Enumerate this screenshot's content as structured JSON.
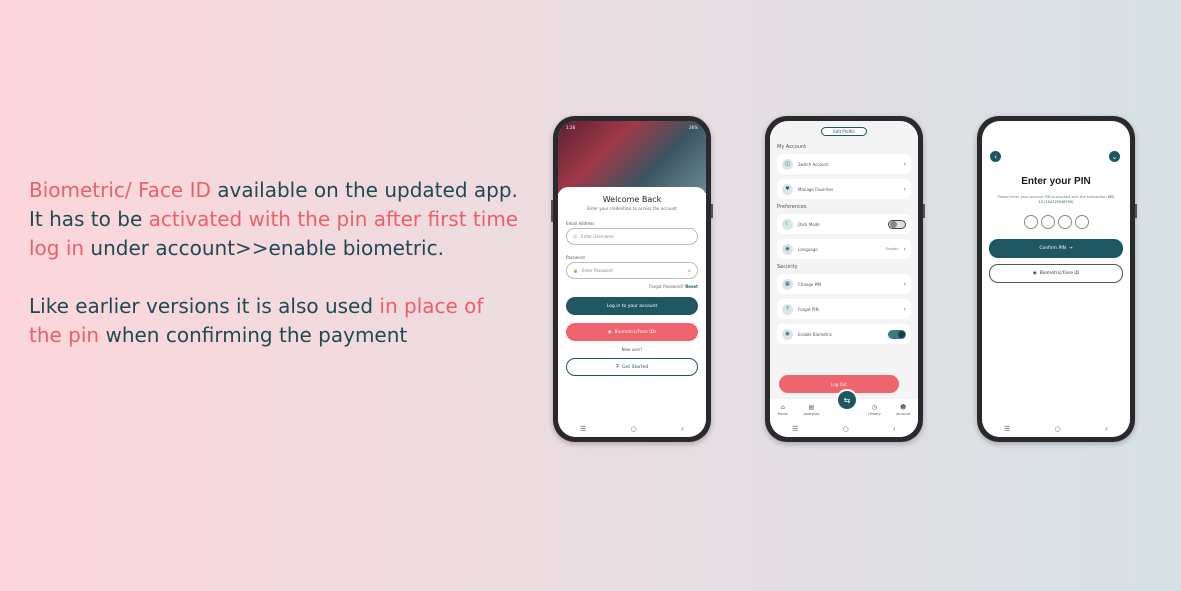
{
  "description": {
    "para1": [
      {
        "text": "Biometric/ Face ID",
        "highlight": true
      },
      {
        "text": " available on the updated app. It has to be ",
        "highlight": false
      },
      {
        "text": "activated with the pin after first time log in",
        "highlight": true
      },
      {
        "text": " under account>>enable biometric.",
        "highlight": false
      }
    ],
    "para2": [
      {
        "text": "Like earlier versions it is also used ",
        "highlight": false
      },
      {
        "text": "in place of the pin",
        "highlight": true
      },
      {
        "text": " when confirming the payment",
        "highlight": false
      }
    ]
  },
  "colors": {
    "highlight": "#ea5f6a",
    "text": "#1f4a55",
    "teal": "#1e5762",
    "coral": "#f06470"
  },
  "phone1": {
    "status_time": "1:28",
    "status_battery": "26%",
    "title": "Welcome Back",
    "subtitle": "Enter your credentials to access the account",
    "email_label": "Email Address",
    "email_placeholder": "Enter Username",
    "password_label": "Password",
    "password_placeholder": "Enter Password",
    "forgot_text": "Forgot Password?",
    "reset_text": "Reset",
    "login_button": "Log in to your account",
    "biometric_button": "Biometric/Face IDs",
    "new_user": "New user?",
    "get_started": "Get Started",
    "icons": {
      "user": "user-icon",
      "lock": "lock-icon",
      "eye": "eye-off-icon",
      "fingerprint": "fingerprint-icon",
      "shield": "shield-check-icon"
    }
  },
  "phone2": {
    "edit_profile": "Edit Profile",
    "section_account": "My Account",
    "switch_account": "Switch Account",
    "manage_favorites": "Manage Favorites",
    "section_preferences": "Preferences",
    "dark_mode": "Dark Mode",
    "language": "Language",
    "language_value": "English",
    "section_security": "Security",
    "change_pin": "Change PIN",
    "forgot_pin": "Forgot PIN",
    "enable_biometric": "Enable Biometric",
    "dark_mode_on": false,
    "biometric_on": true,
    "logout": "Log Out",
    "tabs": [
      "Home",
      "Analytics",
      "History",
      "Account"
    ]
  },
  "phone3": {
    "title": "Enter your PIN",
    "subtitle": "Please enter your account PIN to proceed with the transaction",
    "txn_id": "KES 10 (254725538790)",
    "confirm_button": "Confirm PIN",
    "biometric_button": "Biometric/Face ID"
  }
}
